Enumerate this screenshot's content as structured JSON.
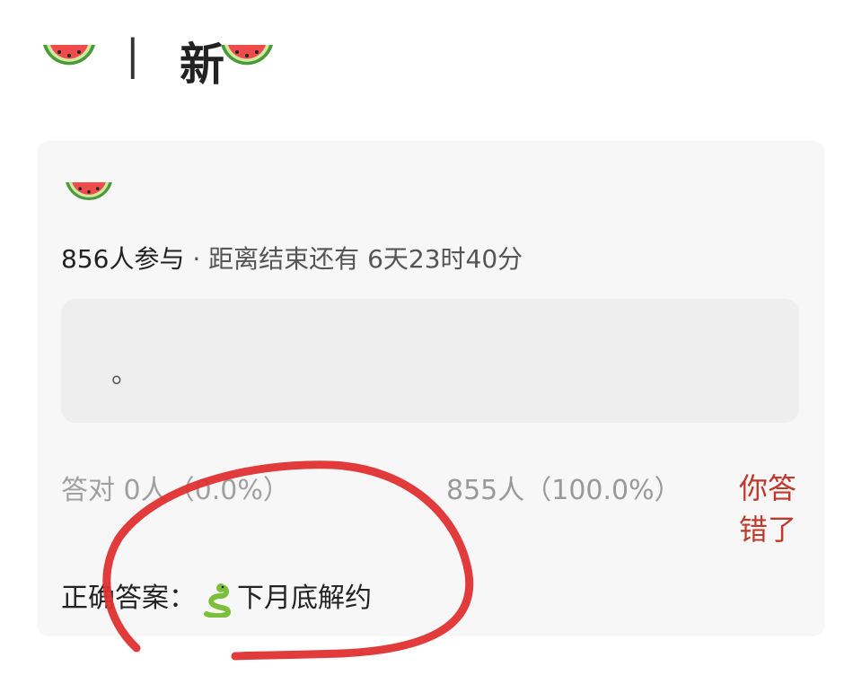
{
  "header": {
    "divider": "|",
    "title": "新",
    "icon_left": "watermelon-icon",
    "icon_right": "watermelon-icon"
  },
  "card": {
    "icon": "watermelon-icon",
    "participants": "856人参与",
    "separator": "·",
    "deadline": "距离结束还有 6天23时40分",
    "option_text": "。",
    "correct_stat": "答对  0人（0.0%）",
    "other_stat": "855人（100.0%）",
    "verdict": "你答错了",
    "answer_label": "正确答案：",
    "answer_icon": "snake-icon",
    "answer_text": "下月底解约"
  },
  "colors": {
    "annotation": "#e03030",
    "verdict": "#c0392b",
    "card_bg": "#f7f7f7"
  }
}
